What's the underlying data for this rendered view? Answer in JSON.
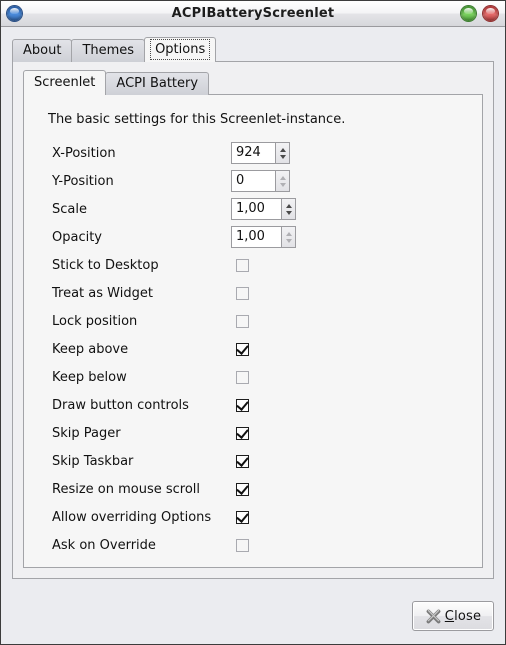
{
  "window": {
    "title": "ACPIBatteryScreenlet",
    "left_button": "app-menu-orb",
    "right_buttons": [
      "minimize-orb",
      "close-orb"
    ]
  },
  "outer_tabs": [
    {
      "label": "About",
      "active": false
    },
    {
      "label": "Themes",
      "active": false
    },
    {
      "label": "Options",
      "active": true
    }
  ],
  "inner_tabs": [
    {
      "label": "Screenlet",
      "active": true
    },
    {
      "label": "ACPI Battery",
      "active": false
    }
  ],
  "panel": {
    "intro": "The basic settings for this Screenlet-instance.",
    "spin_rows": [
      {
        "label": "X-Position",
        "value": "924",
        "entry_width": 44,
        "dim": false
      },
      {
        "label": "Y-Position",
        "value": "0",
        "entry_width": 44,
        "dim": true
      },
      {
        "label": "Scale",
        "value": "1,00",
        "entry_width": 50,
        "dim": false
      },
      {
        "label": "Opacity",
        "value": "1,00",
        "entry_width": 50,
        "dim": true
      }
    ],
    "check_rows": [
      {
        "label": "Stick to Desktop",
        "checked": false
      },
      {
        "label": "Treat as Widget",
        "checked": false
      },
      {
        "label": "Lock position",
        "checked": false
      },
      {
        "label": "Keep above",
        "checked": true
      },
      {
        "label": "Keep below",
        "checked": false
      },
      {
        "label": "Draw button controls",
        "checked": true
      },
      {
        "label": "Skip Pager",
        "checked": true
      },
      {
        "label": "Skip Taskbar",
        "checked": true
      },
      {
        "label": "Resize on mouse scroll",
        "checked": true
      },
      {
        "label": "Allow overriding Options",
        "checked": true
      },
      {
        "label": "Ask on Override",
        "checked": false
      }
    ]
  },
  "footer": {
    "close_mnemonic": "C",
    "close_rest": "lose",
    "close_icon": "close-x-icon"
  },
  "colors": {
    "window_bg": "#ebecf0",
    "panel_bg": "#f6f6f6",
    "border": "#a3a4a8",
    "orb_green": "#7fd463",
    "orb_red": "#e77070",
    "orb_blue": "#4d8ede"
  }
}
